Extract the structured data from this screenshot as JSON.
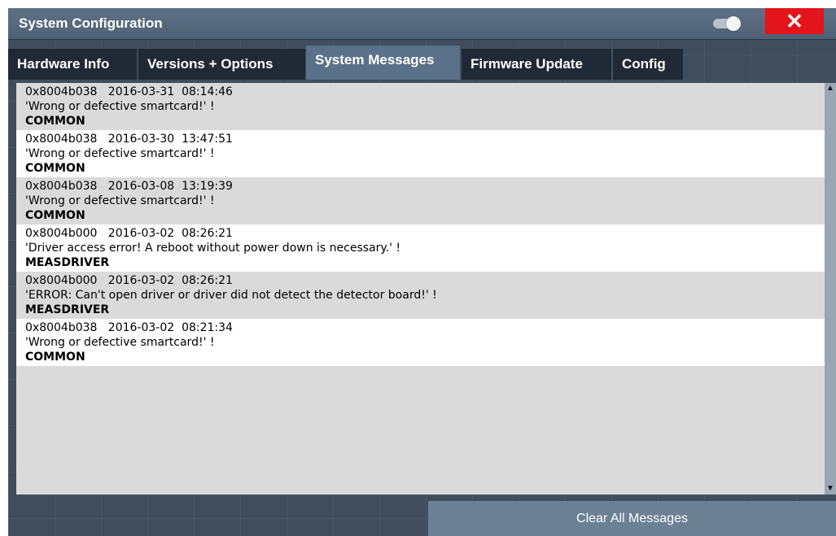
{
  "window": {
    "title": "System Configuration"
  },
  "titlebar": {
    "toggle_icon": "toggle-switch-icon",
    "close_icon": "close-icon",
    "close_symbol": "✕",
    "close_color": "#e3141a"
  },
  "tabs": [
    {
      "label": "Hardware Info",
      "active": false
    },
    {
      "label": "Versions + Options",
      "active": false
    },
    {
      "label": "System Messages",
      "active": true
    },
    {
      "label": "Firmware Update",
      "active": false
    },
    {
      "label": "Config",
      "active": false
    }
  ],
  "messages": [
    {
      "code": "0x8004b038",
      "date": "2016-03-31",
      "time": "08:14:46",
      "text": "'Wrong or defective smartcard!' !",
      "module": "COMMON"
    },
    {
      "code": "0x8004b038",
      "date": "2016-03-30",
      "time": "13:47:51",
      "text": "'Wrong or defective smartcard!' !",
      "module": "COMMON"
    },
    {
      "code": "0x8004b038",
      "date": "2016-03-08",
      "time": "13:19:39",
      "text": "'Wrong or defective smartcard!' !",
      "module": "COMMON"
    },
    {
      "code": "0x8004b000",
      "date": "2016-03-02",
      "time": "08:26:21",
      "text": "'Driver access error! A reboot without power down is necessary.' !",
      "module": "MEASDRIVER"
    },
    {
      "code": "0x8004b000",
      "date": "2016-03-02",
      "time": "08:26:21",
      "text": "'ERROR: Can't open driver or driver did not detect the detector board!' !",
      "module": "MEASDRIVER"
    },
    {
      "code": "0x8004b038",
      "date": "2016-03-02",
      "time": "08:21:34",
      "text": "'Wrong or defective smartcard!' !",
      "module": "COMMON"
    }
  ],
  "scrollbar": {
    "up_icon": "scroll-up-arrow-icon",
    "down_icon": "scroll-down-arrow-icon"
  },
  "footer": {
    "clear_label": "Clear All Messages"
  }
}
